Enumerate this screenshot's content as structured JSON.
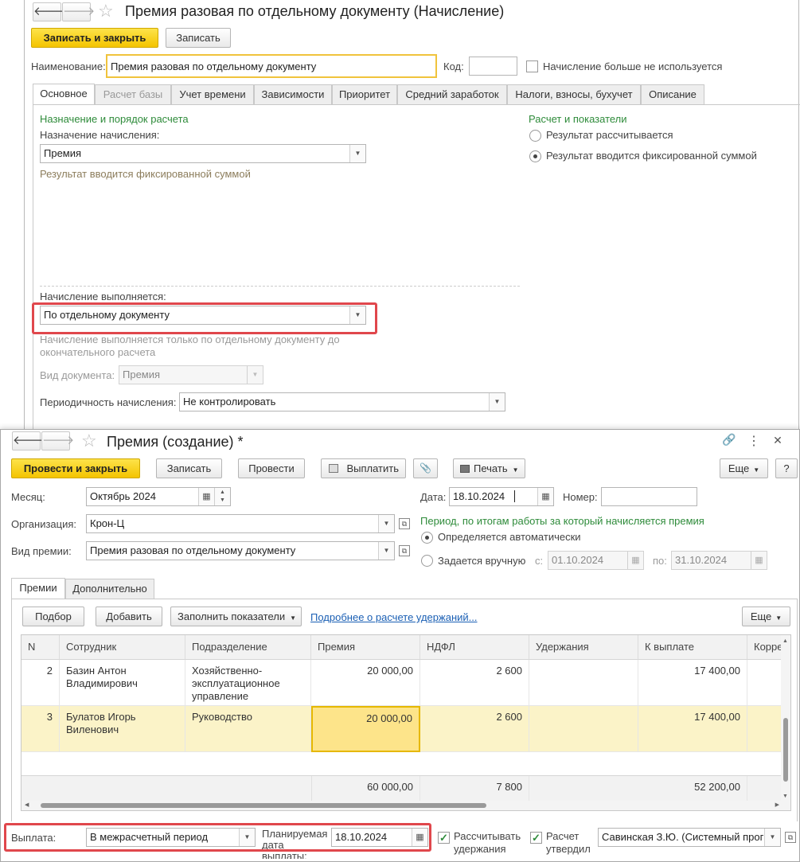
{
  "back_window": {
    "title": "Премия разовая по отдельному документу (Начисление)",
    "nav_back": "🡐",
    "nav_forward": "🡒",
    "star": "☆",
    "toolbar": {
      "save_close": "Записать и закрыть",
      "save": "Записать"
    },
    "name_label": "Наименование:",
    "name_value": "Премия разовая по отдельному документу",
    "code_label": "Код:",
    "code_value": "",
    "not_used_label": "Начисление больше не используется",
    "tabs": [
      "Основное",
      "Расчет базы",
      "Учет времени",
      "Зависимости",
      "Приоритет",
      "Средний заработок",
      "Налоги, взносы, бухучет",
      "Описание"
    ],
    "section_purpose": "Назначение и порядок расчета",
    "purpose_label": "Назначение начисления:",
    "purpose_value": "Премия",
    "purpose_hint": "Результат вводится фиксированной суммой",
    "section_calc": "Расчет и показатели",
    "calc_option1": "Результат рассчитывается",
    "calc_option2": "Результат вводится фиксированной суммой",
    "executed_label": "Начисление выполняется:",
    "executed_value": "По отдельному документу",
    "executed_hint": "Начисление выполняется только по отдельному документу до окончательного расчета",
    "doc_type_label": "Вид документа:",
    "doc_type_value": "Премия",
    "periodicity_label": "Периодичность начисления:",
    "periodicity_value": "Не контролировать"
  },
  "front_window": {
    "title": "Премия (создание) *",
    "nav_back": "🡐",
    "nav_forward": "🡒",
    "star": "☆",
    "window_icons": {
      "link": "🔗",
      "more": "⋮",
      "close": "✕"
    },
    "toolbar": {
      "post_close": "Провести и закрыть",
      "save": "Записать",
      "post": "Провести",
      "pay": "Выплатить",
      "attach_icon": "📎",
      "print": "Печать",
      "more": "Еще",
      "help": "?"
    },
    "month_label": "Месяц:",
    "month_value": "Октябрь 2024",
    "date_label": "Дата:",
    "date_value": "18.10.2024",
    "number_label": "Номер:",
    "number_value": "",
    "org_label": "Организация:",
    "org_value": "Крон-Ц",
    "bonus_type_label": "Вид премии:",
    "bonus_type_value": "Премия разовая по отдельному документу",
    "period_title": "Период, по итогам работы за который начисляется премия",
    "period_auto": "Определяется автоматически",
    "period_manual": "Задается вручную",
    "from_label": "с:",
    "from_value": "01.10.2024",
    "to_label": "по:",
    "to_value": "31.10.2024",
    "tabs": [
      "Премии",
      "Дополнительно"
    ],
    "table_toolbar": {
      "pick": "Подбор",
      "add": "Добавить",
      "fill": "Заполнить показатели",
      "details_link": "Подробнее о расчете удержаний...",
      "more": "Еще"
    },
    "table": {
      "columns": [
        "N",
        "Сотрудник",
        "Подразделение",
        "Премия",
        "НДФЛ",
        "Удержания",
        "К выплате",
        "Корре"
      ],
      "rows": [
        {
          "n": "2",
          "employee": "Базин Антон Владимирович",
          "dept": "Хозяйственно-эксплуатационное управление",
          "bonus": "20 000,00",
          "ndfl": "2 600",
          "deductions": "",
          "payout": "17 400,00"
        },
        {
          "n": "3",
          "employee": "Булатов Игорь Виленович",
          "dept": "Руководство",
          "bonus": "20 000,00",
          "ndfl": "2 600",
          "deductions": "",
          "payout": "17 400,00"
        }
      ],
      "totals": {
        "bonus": "60 000,00",
        "ndfl": "7 800",
        "payout": "52 200,00"
      }
    },
    "payment_label": "Выплата:",
    "payment_value": "В межрасчетный период",
    "planned_label": "Планируемая дата выплаты:",
    "planned_value": "18.10.2024",
    "calc_deductions_label": "Рассчитывать удержания",
    "approved_label": "Расчет утвердил",
    "approver_value": "Савинская З.Ю. (Системный программист)"
  }
}
